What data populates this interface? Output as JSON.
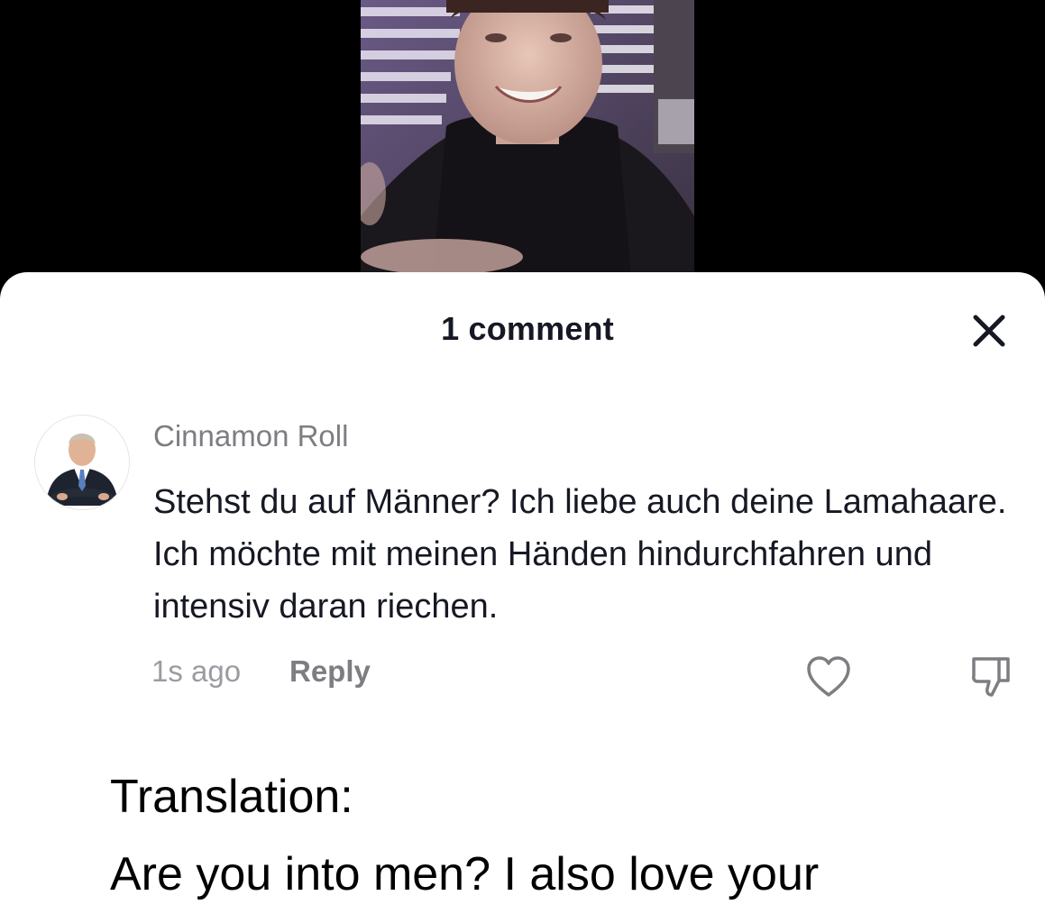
{
  "colors": {
    "background": "#000000",
    "sheet": "#ffffff",
    "primary_text": "#161823",
    "secondary_text": "#7d7d82"
  },
  "video": {
    "icon": "video-frame"
  },
  "header": {
    "title": "1 comment",
    "close_icon": "close-icon"
  },
  "comment": {
    "avatar_icon": "avatar-man-in-suit",
    "username": "Cinnamon Roll",
    "text": "Stehst du auf Männer? Ich liebe auch deine Lamahaare. Ich möchte mit meinen Händen hindurchfahren und intensiv daran riechen.",
    "timestamp": "1s ago",
    "reply_label": "Reply",
    "like_icon": "heart-icon",
    "dislike_icon": "thumbs-down-icon"
  },
  "translation": {
    "label": "Translation:",
    "text": "Are you into men?  I also love your"
  }
}
